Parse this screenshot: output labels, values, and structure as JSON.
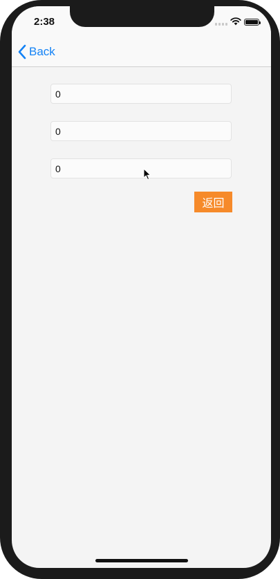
{
  "status_bar": {
    "time": "2:38",
    "icons": [
      "signal-icon",
      "wifi-icon",
      "battery-icon"
    ]
  },
  "nav": {
    "back_icon": "chevron-left-icon",
    "back_label": "Back",
    "accent_color": "#1382f5"
  },
  "form": {
    "fields": [
      {
        "value": "0"
      },
      {
        "value": "0"
      },
      {
        "value": "0"
      }
    ],
    "return_button_label": "返回",
    "button_color": "#f68a2a"
  }
}
